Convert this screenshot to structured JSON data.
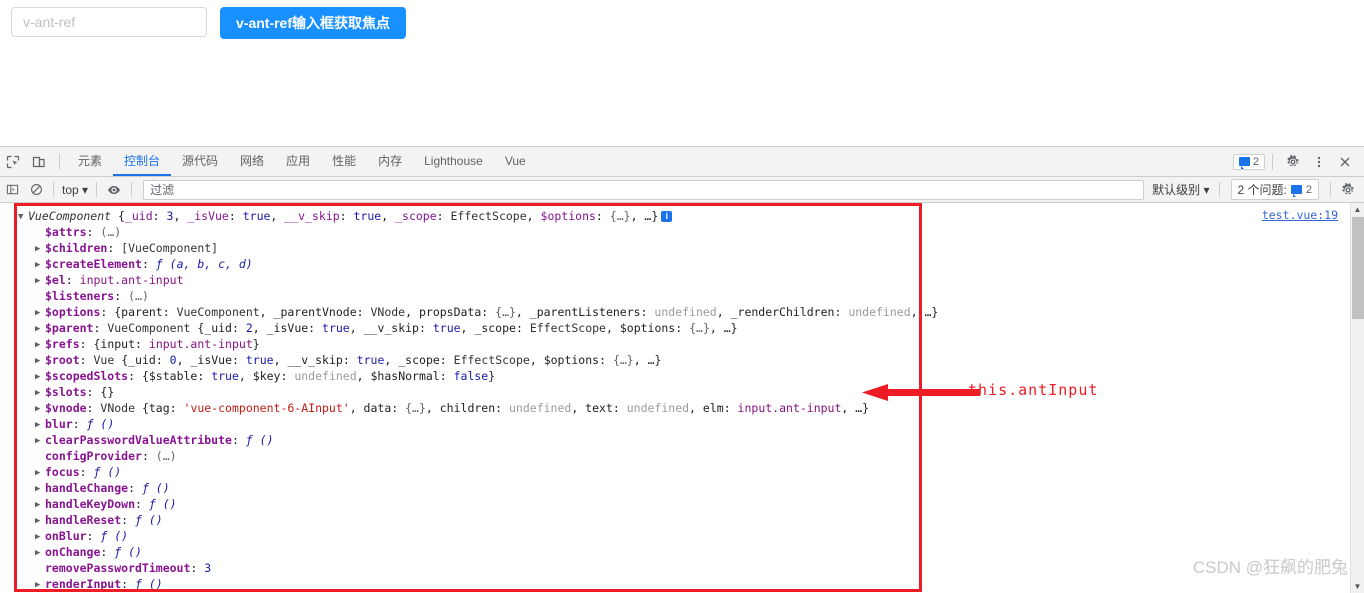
{
  "page": {
    "input_placeholder": "v-ant-ref",
    "input_value": "",
    "focus_button_label": "v-ant-ref输入框获取焦点"
  },
  "devtools": {
    "icons": {
      "inspect": "inspect-element-icon",
      "device": "device-toolbar-icon"
    },
    "tabs": [
      {
        "label": "元素",
        "selected": false
      },
      {
        "label": "控制台",
        "selected": true
      },
      {
        "label": "源代码",
        "selected": false
      },
      {
        "label": "网络",
        "selected": false
      },
      {
        "label": "应用",
        "selected": false
      },
      {
        "label": "性能",
        "selected": false
      },
      {
        "label": "内存",
        "selected": false
      },
      {
        "label": "Lighthouse",
        "selected": false
      },
      {
        "label": "Vue",
        "selected": false
      }
    ],
    "message_badge_count": "2",
    "settings_icon": "gear-icon",
    "more_icon": "kebab-menu-icon",
    "close_icon": "close-icon"
  },
  "filterbar": {
    "sidebar_toggle_icon": "console-sidebar-icon",
    "clear_icon": "clear-console-icon",
    "context": "top",
    "eye_icon": "live-expression-eye-icon",
    "filter_placeholder": "过滤",
    "filter_value": "",
    "level": "默认级别",
    "issues_label": "2 个问题:",
    "issues_count": "2",
    "settings_icon": "console-settings-gear-icon"
  },
  "console": {
    "source_link": "test.vue:19",
    "lines": [
      {
        "indent": 0,
        "marker": "open",
        "parts": [
          {
            "t": "VueComponent ",
            "c": "cls"
          },
          {
            "t": "{",
            "c": "punc"
          },
          {
            "t": "_uid",
            "c": "propn"
          },
          {
            "t": ": ",
            "c": "punc"
          },
          {
            "t": "3",
            "c": "num"
          },
          {
            "t": ", ",
            "c": "punc"
          },
          {
            "t": "_isVue",
            "c": "propn"
          },
          {
            "t": ": ",
            "c": "punc"
          },
          {
            "t": "true",
            "c": "bool"
          },
          {
            "t": ", ",
            "c": "punc"
          },
          {
            "t": "__v_skip",
            "c": "propn"
          },
          {
            "t": ": ",
            "c": "punc"
          },
          {
            "t": "true",
            "c": "bool"
          },
          {
            "t": ", ",
            "c": "punc"
          },
          {
            "t": "_scope",
            "c": "propn"
          },
          {
            "t": ": ",
            "c": "punc"
          },
          {
            "t": "EffectScope",
            "c": "clsn"
          },
          {
            "t": ", ",
            "c": "punc"
          },
          {
            "t": "$options",
            "c": "propn"
          },
          {
            "t": ": ",
            "c": "punc"
          },
          {
            "t": "{…}",
            "c": "ellipsis"
          },
          {
            "t": ", …}",
            "c": "punc"
          }
        ],
        "info": true
      },
      {
        "indent": 1,
        "marker": "none",
        "parts": [
          {
            "t": "$attrs",
            "c": "prop"
          },
          {
            "t": ": ",
            "c": "punc"
          },
          {
            "t": "(…)",
            "c": "ellipsis"
          }
        ]
      },
      {
        "indent": 1,
        "marker": "closed",
        "parts": [
          {
            "t": "$children",
            "c": "prop"
          },
          {
            "t": ": ",
            "c": "punc"
          },
          {
            "t": "[VueComponent]",
            "c": "clsn"
          }
        ]
      },
      {
        "indent": 1,
        "marker": "closed",
        "parts": [
          {
            "t": "$createElement",
            "c": "prop"
          },
          {
            "t": ": ",
            "c": "punc"
          },
          {
            "t": "ƒ (a, b, c, d)",
            "c": "fn"
          }
        ]
      },
      {
        "indent": 1,
        "marker": "closed",
        "parts": [
          {
            "t": "$el",
            "c": "prop"
          },
          {
            "t": ": ",
            "c": "punc"
          },
          {
            "t": "input.ant-input",
            "c": "dom"
          }
        ]
      },
      {
        "indent": 1,
        "marker": "none",
        "parts": [
          {
            "t": "$listeners",
            "c": "prop"
          },
          {
            "t": ": ",
            "c": "punc"
          },
          {
            "t": "(…)",
            "c": "ellipsis"
          }
        ]
      },
      {
        "indent": 1,
        "marker": "closed",
        "parts": [
          {
            "t": "$options",
            "c": "prop"
          },
          {
            "t": ": ",
            "c": "punc"
          },
          {
            "t": "{parent",
            "c": "punc"
          },
          {
            "t": ": ",
            "c": "punc"
          },
          {
            "t": "VueComponent",
            "c": "clsn"
          },
          {
            "t": ", ",
            "c": "punc"
          },
          {
            "t": "_parentVnode",
            "c": "punc"
          },
          {
            "t": ": ",
            "c": "punc"
          },
          {
            "t": "VNode",
            "c": "clsn"
          },
          {
            "t": ", ",
            "c": "punc"
          },
          {
            "t": "propsData",
            "c": "punc"
          },
          {
            "t": ": ",
            "c": "punc"
          },
          {
            "t": "{…}",
            "c": "ellipsis"
          },
          {
            "t": ", ",
            "c": "punc"
          },
          {
            "t": "_parentListeners",
            "c": "punc"
          },
          {
            "t": ": ",
            "c": "punc"
          },
          {
            "t": "undefined",
            "c": "undef"
          },
          {
            "t": ", ",
            "c": "punc"
          },
          {
            "t": "_renderChildren",
            "c": "punc"
          },
          {
            "t": ": ",
            "c": "punc"
          },
          {
            "t": "undefined",
            "c": "undef"
          },
          {
            "t": ", …}",
            "c": "punc"
          }
        ]
      },
      {
        "indent": 1,
        "marker": "closed",
        "parts": [
          {
            "t": "$parent",
            "c": "prop"
          },
          {
            "t": ": ",
            "c": "punc"
          },
          {
            "t": "VueComponent ",
            "c": "clsn"
          },
          {
            "t": "{_uid",
            "c": "punc"
          },
          {
            "t": ": ",
            "c": "punc"
          },
          {
            "t": "2",
            "c": "num"
          },
          {
            "t": ", ",
            "c": "punc"
          },
          {
            "t": "_isVue",
            "c": "punc"
          },
          {
            "t": ": ",
            "c": "punc"
          },
          {
            "t": "true",
            "c": "bool"
          },
          {
            "t": ", ",
            "c": "punc"
          },
          {
            "t": "__v_skip",
            "c": "punc"
          },
          {
            "t": ": ",
            "c": "punc"
          },
          {
            "t": "true",
            "c": "bool"
          },
          {
            "t": ", ",
            "c": "punc"
          },
          {
            "t": "_scope",
            "c": "punc"
          },
          {
            "t": ": ",
            "c": "punc"
          },
          {
            "t": "EffectScope",
            "c": "clsn"
          },
          {
            "t": ", ",
            "c": "punc"
          },
          {
            "t": "$options",
            "c": "punc"
          },
          {
            "t": ": ",
            "c": "punc"
          },
          {
            "t": "{…}",
            "c": "ellipsis"
          },
          {
            "t": ", …}",
            "c": "punc"
          }
        ]
      },
      {
        "indent": 1,
        "marker": "closed",
        "parts": [
          {
            "t": "$refs",
            "c": "prop"
          },
          {
            "t": ": ",
            "c": "punc"
          },
          {
            "t": "{input",
            "c": "punc"
          },
          {
            "t": ": ",
            "c": "punc"
          },
          {
            "t": "input.ant-input",
            "c": "dom"
          },
          {
            "t": "}",
            "c": "punc"
          }
        ]
      },
      {
        "indent": 1,
        "marker": "closed",
        "parts": [
          {
            "t": "$root",
            "c": "prop"
          },
          {
            "t": ": ",
            "c": "punc"
          },
          {
            "t": "Vue ",
            "c": "clsn"
          },
          {
            "t": "{_uid",
            "c": "punc"
          },
          {
            "t": ": ",
            "c": "punc"
          },
          {
            "t": "0",
            "c": "num"
          },
          {
            "t": ", ",
            "c": "punc"
          },
          {
            "t": "_isVue",
            "c": "punc"
          },
          {
            "t": ": ",
            "c": "punc"
          },
          {
            "t": "true",
            "c": "bool"
          },
          {
            "t": ", ",
            "c": "punc"
          },
          {
            "t": "__v_skip",
            "c": "punc"
          },
          {
            "t": ": ",
            "c": "punc"
          },
          {
            "t": "true",
            "c": "bool"
          },
          {
            "t": ", ",
            "c": "punc"
          },
          {
            "t": "_scope",
            "c": "punc"
          },
          {
            "t": ": ",
            "c": "punc"
          },
          {
            "t": "EffectScope",
            "c": "clsn"
          },
          {
            "t": ", ",
            "c": "punc"
          },
          {
            "t": "$options",
            "c": "punc"
          },
          {
            "t": ": ",
            "c": "punc"
          },
          {
            "t": "{…}",
            "c": "ellipsis"
          },
          {
            "t": ", …}",
            "c": "punc"
          }
        ]
      },
      {
        "indent": 1,
        "marker": "closed",
        "parts": [
          {
            "t": "$scopedSlots",
            "c": "prop"
          },
          {
            "t": ": ",
            "c": "punc"
          },
          {
            "t": "{$stable",
            "c": "punc"
          },
          {
            "t": ": ",
            "c": "punc"
          },
          {
            "t": "true",
            "c": "bool"
          },
          {
            "t": ", ",
            "c": "punc"
          },
          {
            "t": "$key",
            "c": "punc"
          },
          {
            "t": ": ",
            "c": "punc"
          },
          {
            "t": "undefined",
            "c": "undef"
          },
          {
            "t": ", ",
            "c": "punc"
          },
          {
            "t": "$hasNormal",
            "c": "punc"
          },
          {
            "t": ": ",
            "c": "punc"
          },
          {
            "t": "false",
            "c": "bool"
          },
          {
            "t": "}",
            "c": "punc"
          }
        ]
      },
      {
        "indent": 1,
        "marker": "closed",
        "parts": [
          {
            "t": "$slots",
            "c": "prop"
          },
          {
            "t": ": ",
            "c": "punc"
          },
          {
            "t": "{}",
            "c": "punc"
          }
        ]
      },
      {
        "indent": 1,
        "marker": "closed",
        "parts": [
          {
            "t": "$vnode",
            "c": "prop"
          },
          {
            "t": ": ",
            "c": "punc"
          },
          {
            "t": "VNode ",
            "c": "clsn"
          },
          {
            "t": "{tag",
            "c": "punc"
          },
          {
            "t": ": ",
            "c": "punc"
          },
          {
            "t": "'vue-component-6-AInput'",
            "c": "str"
          },
          {
            "t": ", ",
            "c": "punc"
          },
          {
            "t": "data",
            "c": "punc"
          },
          {
            "t": ": ",
            "c": "punc"
          },
          {
            "t": "{…}",
            "c": "ellipsis"
          },
          {
            "t": ", ",
            "c": "punc"
          },
          {
            "t": "children",
            "c": "punc"
          },
          {
            "t": ": ",
            "c": "punc"
          },
          {
            "t": "undefined",
            "c": "undef"
          },
          {
            "t": ", ",
            "c": "punc"
          },
          {
            "t": "text",
            "c": "punc"
          },
          {
            "t": ": ",
            "c": "punc"
          },
          {
            "t": "undefined",
            "c": "undef"
          },
          {
            "t": ", ",
            "c": "punc"
          },
          {
            "t": "elm",
            "c": "punc"
          },
          {
            "t": ": ",
            "c": "punc"
          },
          {
            "t": "input.ant-input",
            "c": "dom"
          },
          {
            "t": ", …}",
            "c": "punc"
          }
        ]
      },
      {
        "indent": 1,
        "marker": "closed",
        "parts": [
          {
            "t": "blur",
            "c": "prop"
          },
          {
            "t": ": ",
            "c": "punc"
          },
          {
            "t": "ƒ ()",
            "c": "fn"
          }
        ]
      },
      {
        "indent": 1,
        "marker": "closed",
        "parts": [
          {
            "t": "clearPasswordValueAttribute",
            "c": "prop"
          },
          {
            "t": ": ",
            "c": "punc"
          },
          {
            "t": "ƒ ()",
            "c": "fn"
          }
        ]
      },
      {
        "indent": 1,
        "marker": "none",
        "parts": [
          {
            "t": "configProvider",
            "c": "prop"
          },
          {
            "t": ": ",
            "c": "punc"
          },
          {
            "t": "(…)",
            "c": "ellipsis"
          }
        ]
      },
      {
        "indent": 1,
        "marker": "closed",
        "parts": [
          {
            "t": "focus",
            "c": "prop"
          },
          {
            "t": ": ",
            "c": "punc"
          },
          {
            "t": "ƒ ()",
            "c": "fn"
          }
        ]
      },
      {
        "indent": 1,
        "marker": "closed",
        "parts": [
          {
            "t": "handleChange",
            "c": "prop"
          },
          {
            "t": ": ",
            "c": "punc"
          },
          {
            "t": "ƒ ()",
            "c": "fn"
          }
        ]
      },
      {
        "indent": 1,
        "marker": "closed",
        "parts": [
          {
            "t": "handleKeyDown",
            "c": "prop"
          },
          {
            "t": ": ",
            "c": "punc"
          },
          {
            "t": "ƒ ()",
            "c": "fn"
          }
        ]
      },
      {
        "indent": 1,
        "marker": "closed",
        "parts": [
          {
            "t": "handleReset",
            "c": "prop"
          },
          {
            "t": ": ",
            "c": "punc"
          },
          {
            "t": "ƒ ()",
            "c": "fn"
          }
        ]
      },
      {
        "indent": 1,
        "marker": "closed",
        "parts": [
          {
            "t": "onBlur",
            "c": "prop"
          },
          {
            "t": ": ",
            "c": "punc"
          },
          {
            "t": "ƒ ()",
            "c": "fn"
          }
        ]
      },
      {
        "indent": 1,
        "marker": "closed",
        "parts": [
          {
            "t": "onChange",
            "c": "prop"
          },
          {
            "t": ": ",
            "c": "punc"
          },
          {
            "t": "ƒ ()",
            "c": "fn"
          }
        ]
      },
      {
        "indent": 1,
        "marker": "none",
        "parts": [
          {
            "t": "removePasswordTimeout",
            "c": "prop"
          },
          {
            "t": ": ",
            "c": "punc"
          },
          {
            "t": "3",
            "c": "num"
          }
        ]
      },
      {
        "indent": 1,
        "marker": "closed",
        "parts": [
          {
            "t": "renderInput",
            "c": "prop"
          },
          {
            "t": ": ",
            "c": "punc"
          },
          {
            "t": "ƒ ()",
            "c": "fn"
          }
        ]
      }
    ]
  },
  "annotation": {
    "label": "this.antInput",
    "color": "#ee1c25"
  },
  "watermark": "CSDN @狂飙的肥兔"
}
